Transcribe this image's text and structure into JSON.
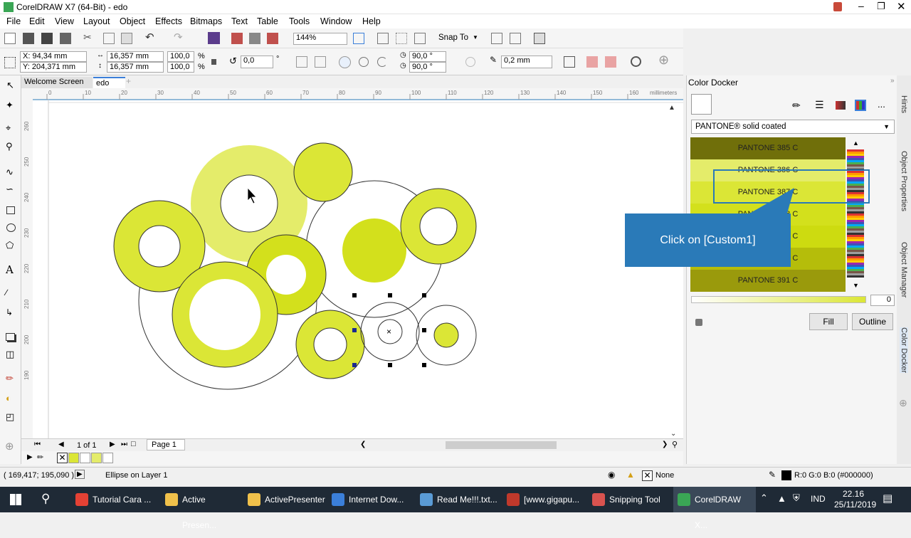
{
  "window": {
    "title": "CorelDRAW X7 (64-Bit) - edo"
  },
  "menu": [
    "File",
    "Edit",
    "View",
    "Layout",
    "Object",
    "Effects",
    "Bitmaps",
    "Text",
    "Table",
    "Tools",
    "Window",
    "Help"
  ],
  "toolbar": {
    "zoom": "144%",
    "snap_to": "Snap To"
  },
  "properties": {
    "x": "X: 94,34 mm",
    "y": "Y: 204,371 mm",
    "w": "16,357 mm",
    "h": "16,357 mm",
    "scale_w": "100,0",
    "scale_h": "100,0",
    "pct": "%",
    "angle": "0,0",
    "degree": "°",
    "arc_start": "90,0 °",
    "arc_end": "90,0 °",
    "outline_width": "0,2 mm"
  },
  "doc_tabs": [
    "Welcome Screen",
    "edo"
  ],
  "ruler": {
    "unit": "millimeters",
    "h_ticks": [
      "0",
      "10",
      "20",
      "30",
      "40",
      "50",
      "60",
      "70",
      "80",
      "90",
      "100",
      "110",
      "120",
      "130",
      "140",
      "150",
      "160"
    ]
  },
  "page_nav": {
    "counter": "1 of 1",
    "page_tab": "Page 1"
  },
  "docker": {
    "title": "Color Docker",
    "palette": "PANTONE® solid coated",
    "swatches": [
      {
        "name": "PANTONE 385 C",
        "color": "#706f0a"
      },
      {
        "name": "PANTONE 386 C",
        "color": "#e4ec6a"
      },
      {
        "name": "PANTONE 387 C",
        "color": "#dbe636"
      },
      {
        "name": "PANTONE 388 C",
        "color": "#d3e01c"
      },
      {
        "name": "PANTONE 389 C",
        "color": "#cddb10"
      },
      {
        "name": "PANTONE 390 C",
        "color": "#b5bd0a"
      },
      {
        "name": "PANTONE 391 C",
        "color": "#9a9a0c"
      }
    ],
    "tint_value": "0",
    "fill_button": "Fill",
    "outline_button": "Outline",
    "more": "..."
  },
  "callout": {
    "text": "Click on [Custom1]"
  },
  "side_tabs": [
    "Hints",
    "Object Properties",
    "Object Manager",
    "Color Docker"
  ],
  "status": {
    "coords": "( 169,417; 195,090 )",
    "object_info": "Ellipse on Layer 1",
    "fill_label": "None",
    "outline_color": "R:0 G:0 B:0 (#000000)"
  },
  "taskbar": {
    "items": [
      {
        "label": "Tutorial Cara ...",
        "color": "#e44134"
      },
      {
        "label": "Active Presen...",
        "color": "#f0c14b"
      },
      {
        "label": "ActivePresenter",
        "color": "#f0c14b"
      },
      {
        "label": "Internet Dow...",
        "color": "#3b7fd9"
      },
      {
        "label": "Read Me!!!.txt...",
        "color": "#5a9bd5"
      },
      {
        "label": "[www.gigapu...",
        "color": "#c0392b"
      },
      {
        "label": "Snipping Tool",
        "color": "#d9534f"
      },
      {
        "label": "CorelDRAW X...",
        "color": "#3aa655"
      }
    ],
    "lang": "IND",
    "time": "22.16",
    "date": "25/11/2019"
  },
  "colors": {
    "lime": "#dbe636",
    "lime_light": "#e4ec6a",
    "accent_blue": "#2a7ab8"
  }
}
